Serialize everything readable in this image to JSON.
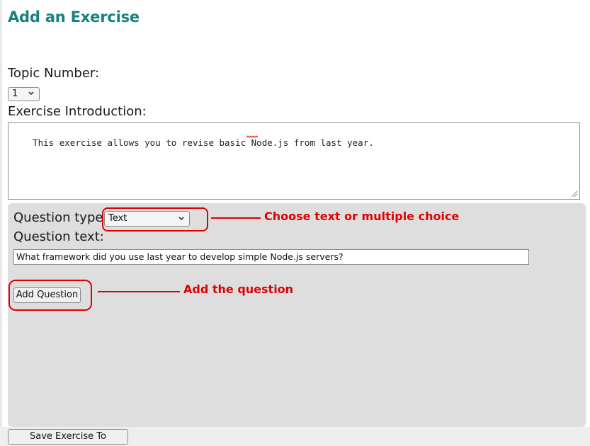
{
  "page": {
    "title": "Add an Exercise"
  },
  "form": {
    "topic_label": "Topic Number:",
    "topic_value": "1",
    "intro_label": "Exercise Introduction:",
    "intro_value": "This exercise allows you to revise basic Node.js from last year.",
    "question_type_label": "Question type",
    "question_type_value": "Text",
    "question_text_label": "Question text:",
    "question_text_value": "What framework did you use last year to develop simple Node.js servers?",
    "add_question_label": "Add Question",
    "save_label": "Save Exercise To Database"
  },
  "annotations": {
    "type_hint": "Choose text or multiple choice",
    "add_hint": "Add the question",
    "color": "#e00000"
  },
  "theme": {
    "title_color": "#1a7f7f",
    "panel_color": "#dedede"
  }
}
